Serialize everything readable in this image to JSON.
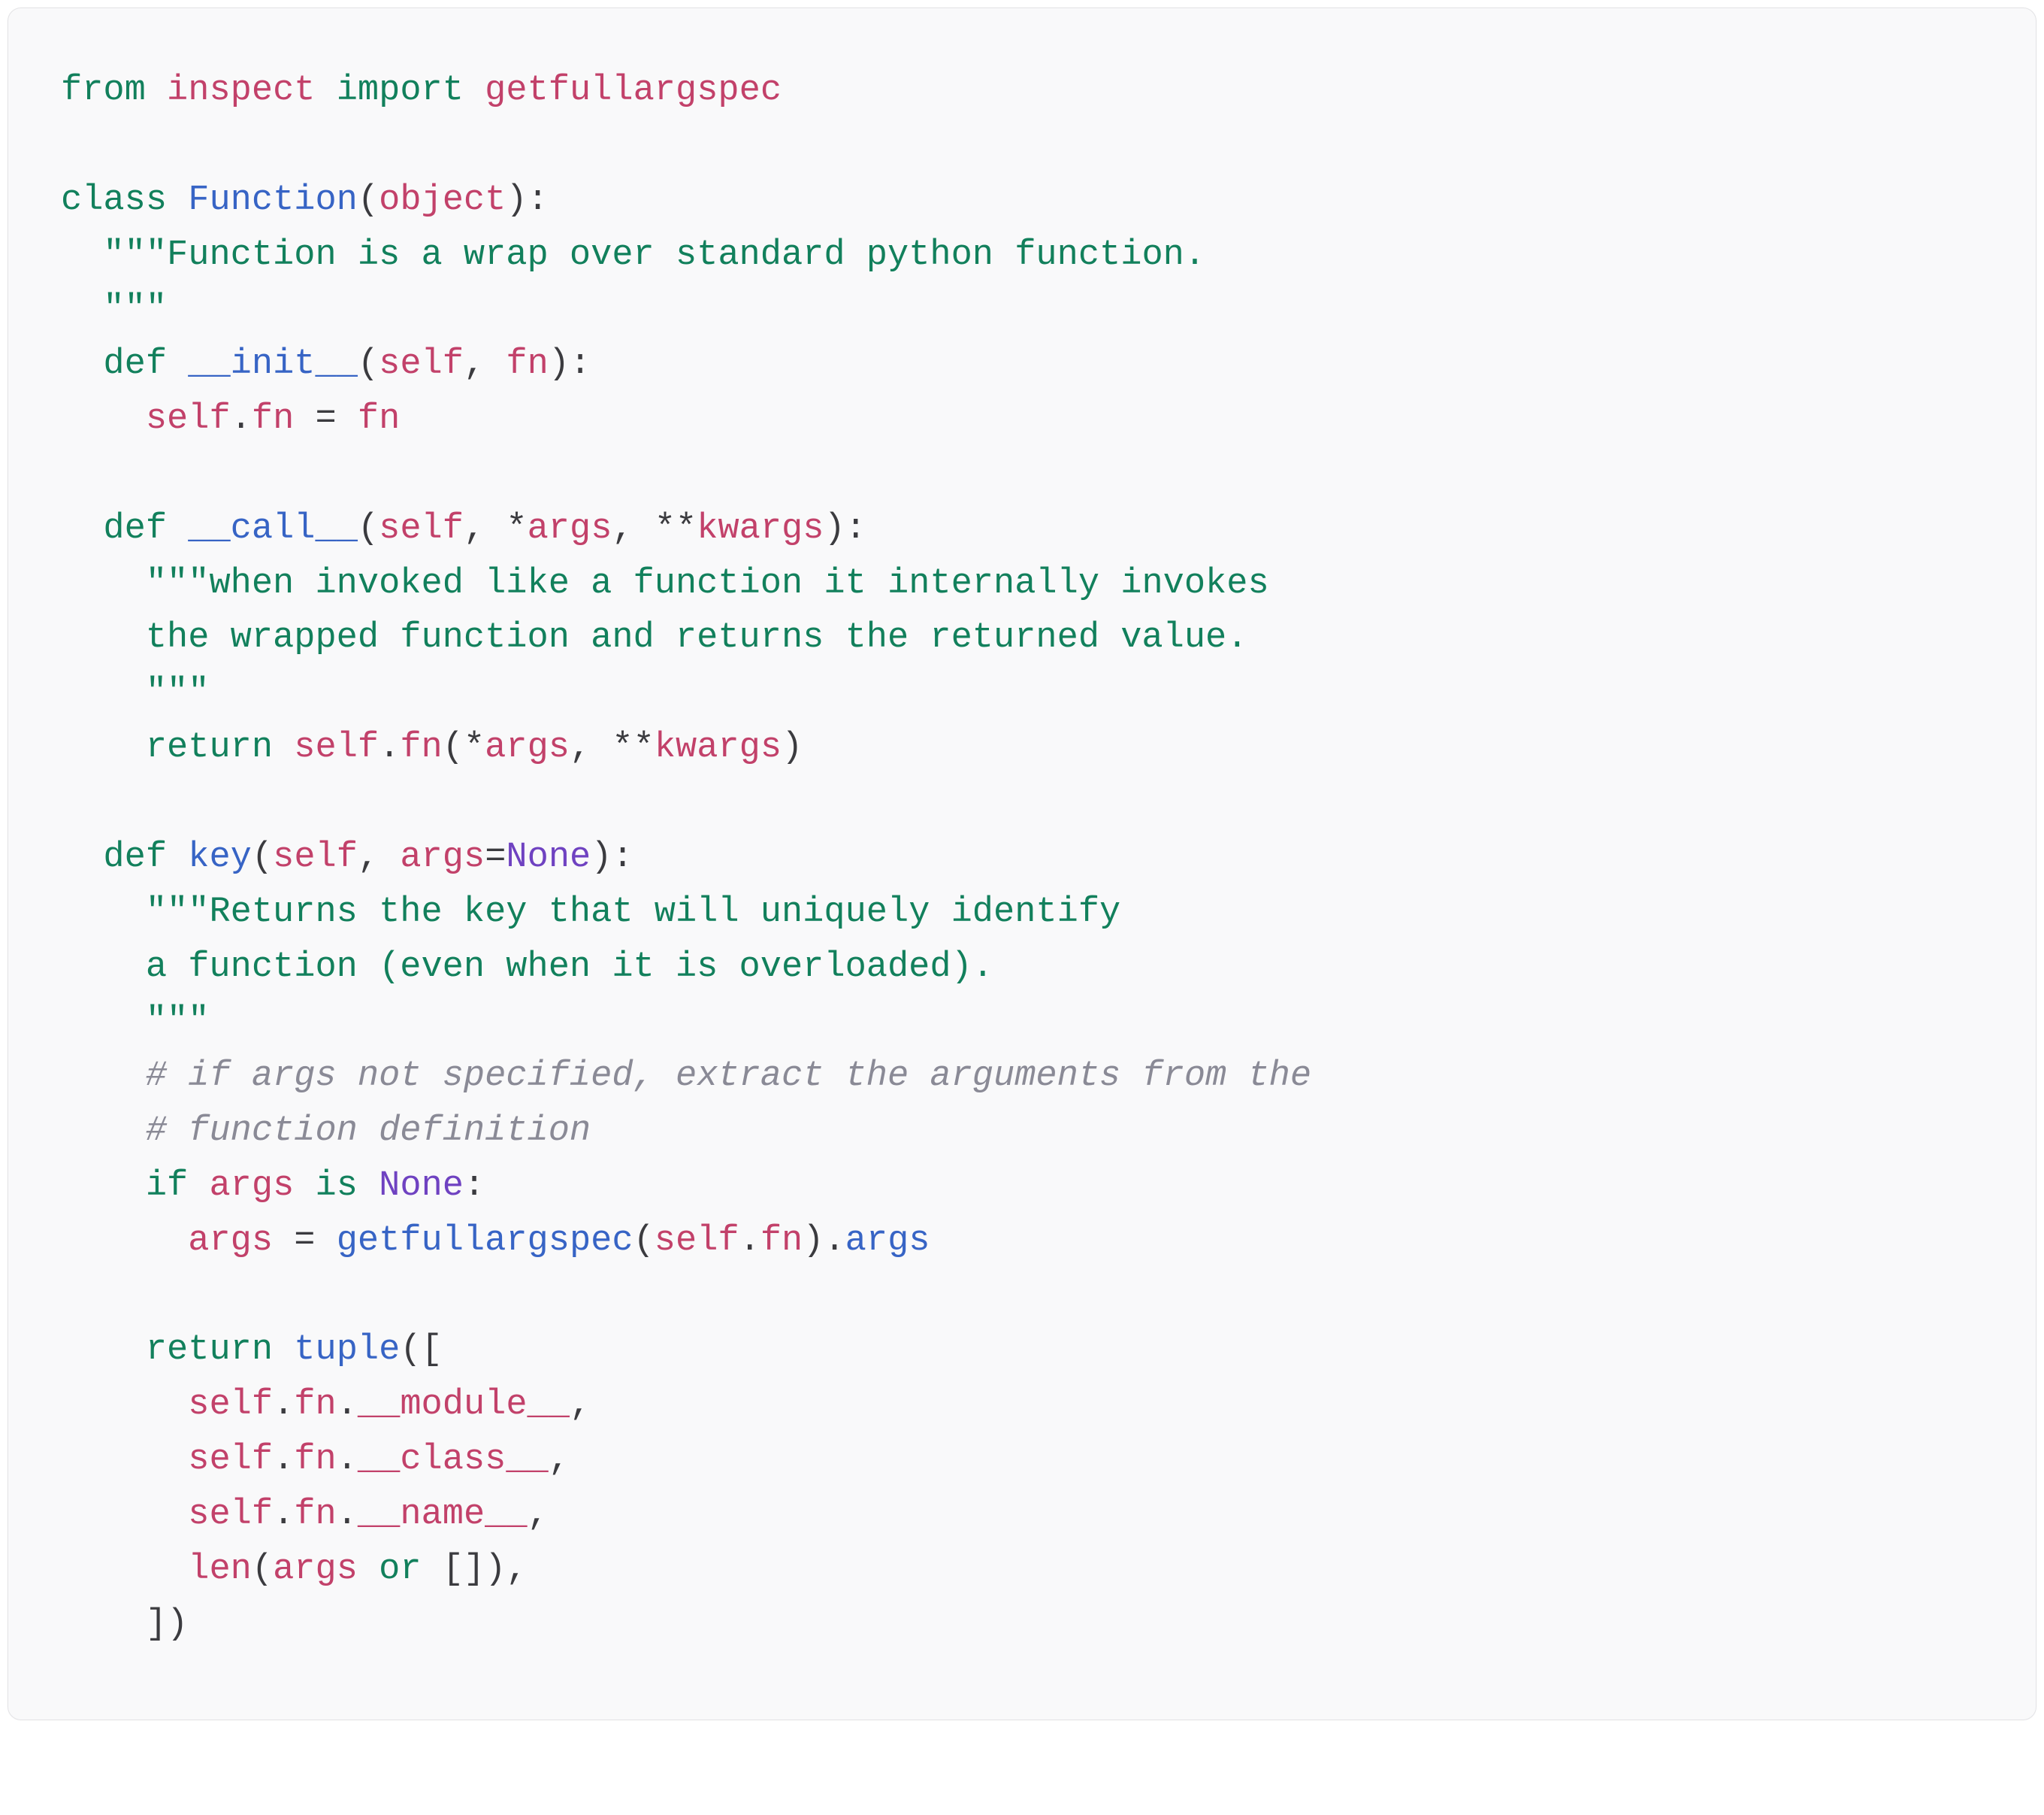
{
  "code": {
    "language": "python",
    "lines": [
      [
        {
          "cls": "kw",
          "t": "from"
        },
        {
          "cls": "txt",
          "t": " "
        },
        {
          "cls": "mod",
          "t": "inspect"
        },
        {
          "cls": "txt",
          "t": " "
        },
        {
          "cls": "kw",
          "t": "import"
        },
        {
          "cls": "txt",
          "t": " "
        },
        {
          "cls": "mod",
          "t": "getfullargspec"
        }
      ],
      [],
      [
        {
          "cls": "kw",
          "t": "class"
        },
        {
          "cls": "txt",
          "t": " "
        },
        {
          "cls": "fn",
          "t": "Function"
        },
        {
          "cls": "txt",
          "t": "("
        },
        {
          "cls": "mod",
          "t": "object"
        },
        {
          "cls": "txt",
          "t": "):"
        }
      ],
      [
        {
          "cls": "txt",
          "t": "  "
        },
        {
          "cls": "str",
          "t": "\"\"\"Function is a wrap over standard python function."
        }
      ],
      [
        {
          "cls": "str",
          "t": "  \"\"\""
        }
      ],
      [
        {
          "cls": "txt",
          "t": "  "
        },
        {
          "cls": "kw",
          "t": "def"
        },
        {
          "cls": "txt",
          "t": " "
        },
        {
          "cls": "fn",
          "t": "__init__"
        },
        {
          "cls": "txt",
          "t": "("
        },
        {
          "cls": "mod",
          "t": "self"
        },
        {
          "cls": "txt",
          "t": ", "
        },
        {
          "cls": "mod",
          "t": "fn"
        },
        {
          "cls": "txt",
          "t": "):"
        }
      ],
      [
        {
          "cls": "txt",
          "t": "    "
        },
        {
          "cls": "mod",
          "t": "self"
        },
        {
          "cls": "txt",
          "t": "."
        },
        {
          "cls": "mod",
          "t": "fn"
        },
        {
          "cls": "txt",
          "t": " = "
        },
        {
          "cls": "mod",
          "t": "fn"
        }
      ],
      [],
      [
        {
          "cls": "txt",
          "t": "  "
        },
        {
          "cls": "kw",
          "t": "def"
        },
        {
          "cls": "txt",
          "t": " "
        },
        {
          "cls": "fn",
          "t": "__call__"
        },
        {
          "cls": "txt",
          "t": "("
        },
        {
          "cls": "mod",
          "t": "self"
        },
        {
          "cls": "txt",
          "t": ", *"
        },
        {
          "cls": "mod",
          "t": "args"
        },
        {
          "cls": "txt",
          "t": ", **"
        },
        {
          "cls": "mod",
          "t": "kwargs"
        },
        {
          "cls": "txt",
          "t": "):"
        }
      ],
      [
        {
          "cls": "txt",
          "t": "    "
        },
        {
          "cls": "str",
          "t": "\"\"\"when invoked like a function it internally invokes"
        }
      ],
      [
        {
          "cls": "str",
          "t": "    the wrapped function and returns the returned value."
        }
      ],
      [
        {
          "cls": "str",
          "t": "    \"\"\""
        }
      ],
      [
        {
          "cls": "txt",
          "t": "    "
        },
        {
          "cls": "kw",
          "t": "return"
        },
        {
          "cls": "txt",
          "t": " "
        },
        {
          "cls": "mod",
          "t": "self"
        },
        {
          "cls": "txt",
          "t": "."
        },
        {
          "cls": "mod",
          "t": "fn"
        },
        {
          "cls": "txt",
          "t": "(*"
        },
        {
          "cls": "mod",
          "t": "args"
        },
        {
          "cls": "txt",
          "t": ", **"
        },
        {
          "cls": "mod",
          "t": "kwargs"
        },
        {
          "cls": "txt",
          "t": ")"
        }
      ],
      [],
      [
        {
          "cls": "txt",
          "t": "  "
        },
        {
          "cls": "kw",
          "t": "def"
        },
        {
          "cls": "txt",
          "t": " "
        },
        {
          "cls": "fn",
          "t": "key"
        },
        {
          "cls": "txt",
          "t": "("
        },
        {
          "cls": "mod",
          "t": "self"
        },
        {
          "cls": "txt",
          "t": ", "
        },
        {
          "cls": "mod",
          "t": "args"
        },
        {
          "cls": "txt",
          "t": "="
        },
        {
          "cls": "none",
          "t": "None"
        },
        {
          "cls": "txt",
          "t": "):"
        }
      ],
      [
        {
          "cls": "txt",
          "t": "    "
        },
        {
          "cls": "str",
          "t": "\"\"\"Returns the key that will uniquely identify"
        }
      ],
      [
        {
          "cls": "str",
          "t": "    a function (even when it is overloaded)."
        }
      ],
      [
        {
          "cls": "str",
          "t": "    \"\"\""
        }
      ],
      [
        {
          "cls": "txt",
          "t": "    "
        },
        {
          "cls": "cmt",
          "t": "# if args not specified, extract the arguments from the"
        }
      ],
      [
        {
          "cls": "txt",
          "t": "    "
        },
        {
          "cls": "cmt",
          "t": "# function definition"
        }
      ],
      [
        {
          "cls": "txt",
          "t": "    "
        },
        {
          "cls": "kw",
          "t": "if"
        },
        {
          "cls": "txt",
          "t": " "
        },
        {
          "cls": "mod",
          "t": "args"
        },
        {
          "cls": "txt",
          "t": " "
        },
        {
          "cls": "kw",
          "t": "is"
        },
        {
          "cls": "txt",
          "t": " "
        },
        {
          "cls": "none",
          "t": "None"
        },
        {
          "cls": "txt",
          "t": ":"
        }
      ],
      [
        {
          "cls": "txt",
          "t": "      "
        },
        {
          "cls": "mod",
          "t": "args"
        },
        {
          "cls": "txt",
          "t": " = "
        },
        {
          "cls": "fn",
          "t": "getfullargspec"
        },
        {
          "cls": "txt",
          "t": "("
        },
        {
          "cls": "mod",
          "t": "self"
        },
        {
          "cls": "txt",
          "t": "."
        },
        {
          "cls": "mod",
          "t": "fn"
        },
        {
          "cls": "txt",
          "t": ")."
        },
        {
          "cls": "fn",
          "t": "args"
        }
      ],
      [],
      [
        {
          "cls": "txt",
          "t": "    "
        },
        {
          "cls": "kw",
          "t": "return"
        },
        {
          "cls": "txt",
          "t": " "
        },
        {
          "cls": "fn",
          "t": "tuple"
        },
        {
          "cls": "txt",
          "t": "(["
        }
      ],
      [
        {
          "cls": "txt",
          "t": "      "
        },
        {
          "cls": "mod",
          "t": "self"
        },
        {
          "cls": "txt",
          "t": "."
        },
        {
          "cls": "mod",
          "t": "fn"
        },
        {
          "cls": "txt",
          "t": "."
        },
        {
          "cls": "mod",
          "t": "__module__"
        },
        {
          "cls": "txt",
          "t": ","
        }
      ],
      [
        {
          "cls": "txt",
          "t": "      "
        },
        {
          "cls": "mod",
          "t": "self"
        },
        {
          "cls": "txt",
          "t": "."
        },
        {
          "cls": "mod",
          "t": "fn"
        },
        {
          "cls": "txt",
          "t": "."
        },
        {
          "cls": "mod",
          "t": "__class__"
        },
        {
          "cls": "txt",
          "t": ","
        }
      ],
      [
        {
          "cls": "txt",
          "t": "      "
        },
        {
          "cls": "mod",
          "t": "self"
        },
        {
          "cls": "txt",
          "t": "."
        },
        {
          "cls": "mod",
          "t": "fn"
        },
        {
          "cls": "txt",
          "t": "."
        },
        {
          "cls": "mod",
          "t": "__name__"
        },
        {
          "cls": "txt",
          "t": ","
        }
      ],
      [
        {
          "cls": "txt",
          "t": "      "
        },
        {
          "cls": "mod",
          "t": "len"
        },
        {
          "cls": "txt",
          "t": "("
        },
        {
          "cls": "mod",
          "t": "args"
        },
        {
          "cls": "txt",
          "t": " "
        },
        {
          "cls": "kw",
          "t": "or"
        },
        {
          "cls": "txt",
          "t": " []),"
        }
      ],
      [
        {
          "cls": "txt",
          "t": "    ])"
        }
      ]
    ]
  }
}
